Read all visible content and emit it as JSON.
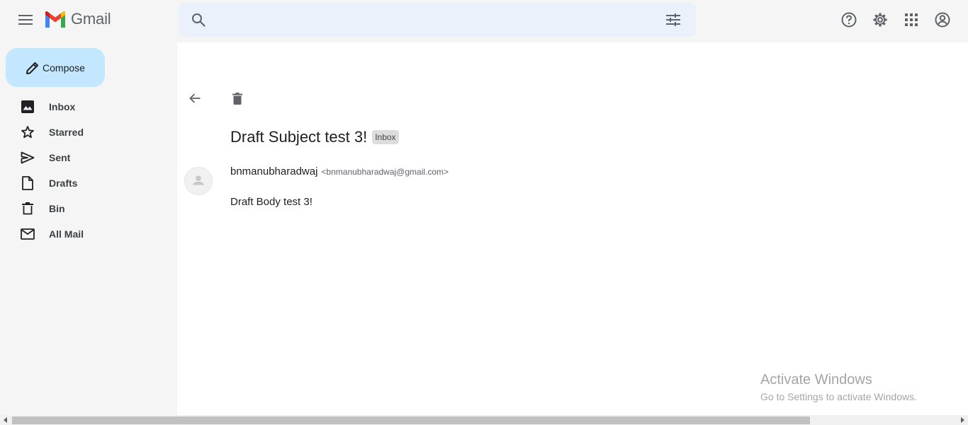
{
  "header": {
    "app_name": "Gmail",
    "search_placeholder": "",
    "icons": [
      "menu-icon",
      "gmail-logo",
      "search-icon",
      "tune-icon",
      "help-icon",
      "settings-icon",
      "apps-icon",
      "account-icon"
    ]
  },
  "sidebar": {
    "compose_label": "Compose",
    "items": [
      {
        "label": "Inbox",
        "icon": "inbox-icon"
      },
      {
        "label": "Starred",
        "icon": "star-icon"
      },
      {
        "label": "Sent",
        "icon": "send-icon"
      },
      {
        "label": "Drafts",
        "icon": "draft-icon"
      },
      {
        "label": "Bin",
        "icon": "bin-icon"
      },
      {
        "label": "All Mail",
        "icon": "mail-icon"
      }
    ]
  },
  "message": {
    "subject": "Draft Subject test 3!",
    "label": "Inbox",
    "sender_name": "bnmanubharadwaj",
    "sender_email": "<bnmanubharadwaj@gmail.com>",
    "body": "Draft Body test 3!"
  },
  "watermark": {
    "line1": "Activate Windows",
    "line2": "Go to Settings to activate Windows."
  },
  "colors": {
    "compose_bg": "#c2e7ff",
    "search_bg": "#eaf1fb",
    "gmail_red": "#ea4335",
    "gmail_blue": "#4285f4",
    "gmail_green": "#34a853",
    "gmail_yellow": "#fbbc04"
  }
}
